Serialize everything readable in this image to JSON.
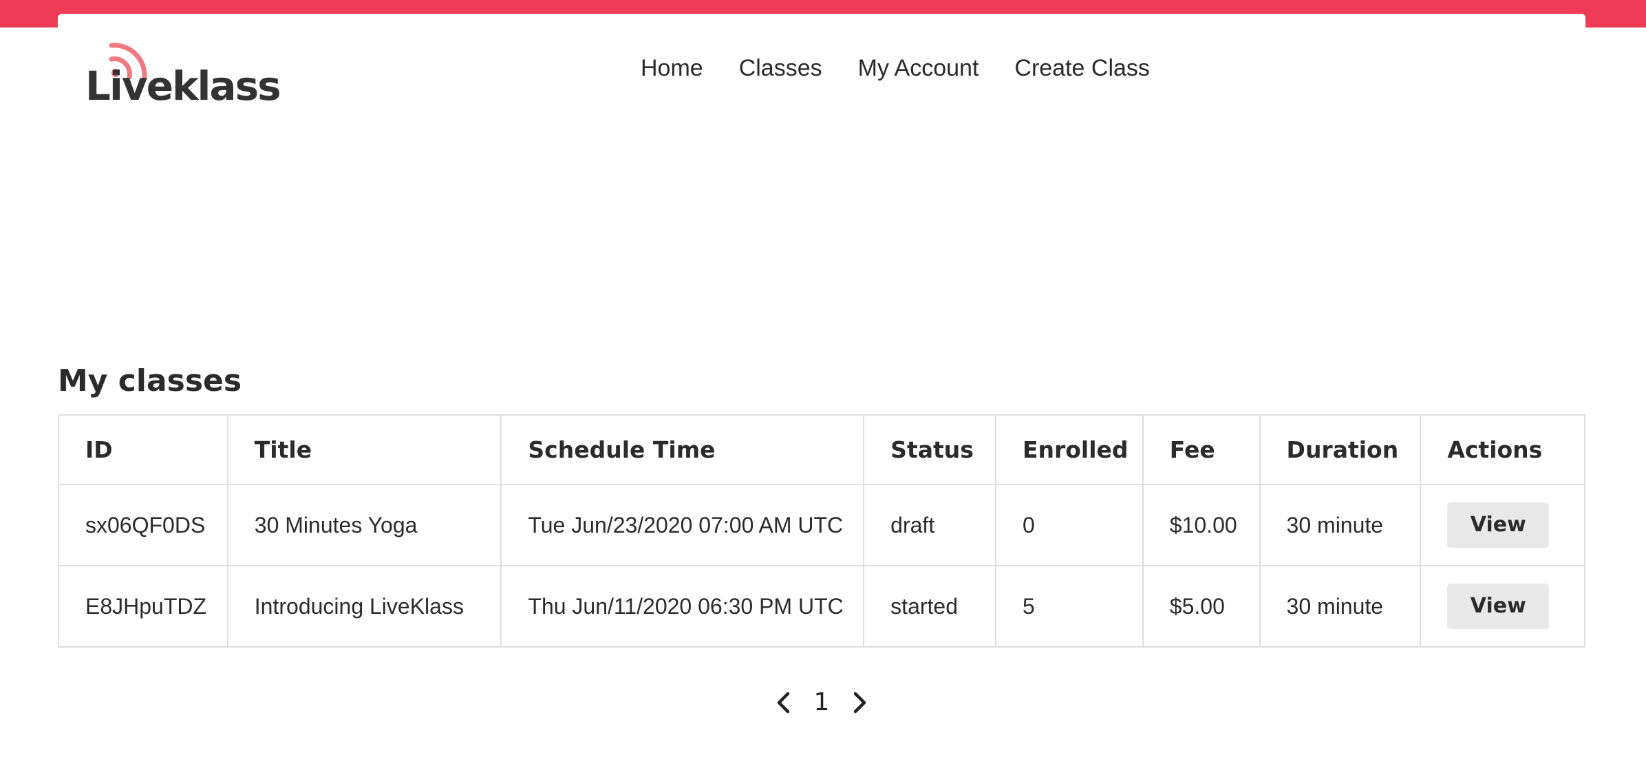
{
  "brand": {
    "name": "Liveklass",
    "accent_color": "#ef3b55",
    "logo_icon": "wifi-signal-icon"
  },
  "nav": {
    "items": [
      {
        "label": "Home"
      },
      {
        "label": "Classes"
      },
      {
        "label": "My Account"
      },
      {
        "label": "Create Class"
      }
    ]
  },
  "main": {
    "title": "My classes",
    "table": {
      "columns": [
        "ID",
        "Title",
        "Schedule Time",
        "Status",
        "Enrolled",
        "Fee",
        "Duration",
        "Actions"
      ],
      "rows": [
        {
          "id": "sx06QF0DS",
          "title": "30 Minutes Yoga",
          "schedule": "Tue Jun/23/2020 07:00 AM UTC",
          "status": "draft",
          "enrolled": "0",
          "fee": "$10.00",
          "duration": "30 minute",
          "action_label": "View"
        },
        {
          "id": "E8JHpuTDZ",
          "title": "Introducing LiveKlass",
          "schedule": "Thu Jun/11/2020 06:30 PM UTC",
          "status": "started",
          "enrolled": "5",
          "fee": "$5.00",
          "duration": "30 minute",
          "action_label": "View"
        }
      ]
    },
    "pagination": {
      "current_page": "1",
      "prev_icon": "chevron-left-icon",
      "next_icon": "chevron-right-icon"
    }
  }
}
